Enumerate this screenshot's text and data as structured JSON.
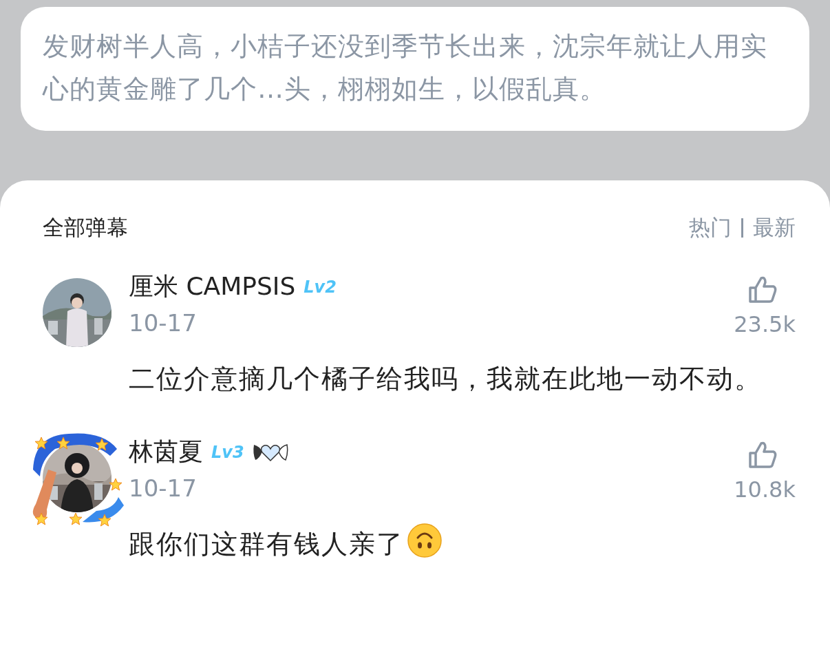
{
  "quote": {
    "text": "发财树半人高，小桔子还没到季节长出来，沈宗年就让人用实心的黄金雕了几个…头，栩栩如生，以假乱真。"
  },
  "panel": {
    "title": "全部弹幕",
    "sort_options": [
      {
        "label": "热门"
      },
      {
        "label": "最新"
      }
    ]
  },
  "comments": [
    {
      "user": "厘米 CAMPSIS",
      "level_badge": "Lv2",
      "avatar_frame": false,
      "wing_badge": false,
      "date": "10-17",
      "likes": "23.5k",
      "text": "二位介意摘几个橘子给我吗，我就在此地一动不动。",
      "emoji": false
    },
    {
      "user": "林茵夏",
      "level_badge": "Lv3",
      "avatar_frame": true,
      "wing_badge": true,
      "date": "10-17",
      "likes": "10.8k",
      "text": "跟你们这群有钱人亲了",
      "emoji": true
    }
  ]
}
